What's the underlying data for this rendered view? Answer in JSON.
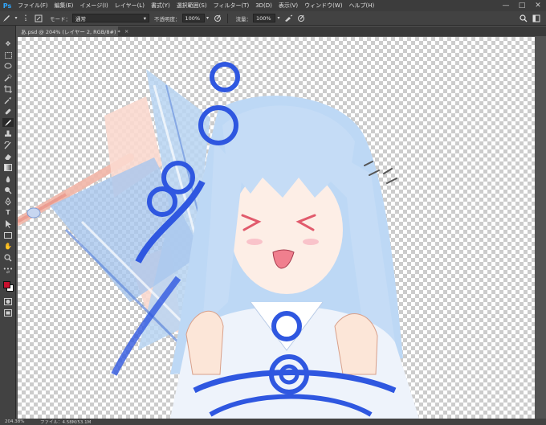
{
  "app": {
    "logo": "Ps"
  },
  "menu": [
    "ファイル(F)",
    "編集(E)",
    "イメージ(I)",
    "レイヤー(L)",
    "書式(Y)",
    "選択範囲(S)",
    "フィルター(T)",
    "3D(D)",
    "表示(V)",
    "ウィンドウ(W)",
    "ヘルプ(H)"
  ],
  "window_controls": {
    "minimize": "—",
    "maximize": "□",
    "close": "✕"
  },
  "options": {
    "brush_size": "1",
    "mode_label": "モード：",
    "mode_value": "通常",
    "opacity_label": "不透明度：",
    "opacity_value": "100%",
    "flow_label": "流量：",
    "flow_value": "100%"
  },
  "document": {
    "tab_title": "あ.psd @ 204% (レイヤー 2, RGB/8#) *",
    "close": "×"
  },
  "status": {
    "zoom": "204.38%",
    "file_info": "ファイル：4.58M/53.1M"
  },
  "colors": {
    "foreground": "#c8102e",
    "background": "#ffffff",
    "accent": "#31a8ff"
  },
  "icons": [
    "move-icon",
    "marquee-icon",
    "lasso-icon",
    "quick-select-icon",
    "crop-icon",
    "eyedropper-icon",
    "healing-icon",
    "brush-icon",
    "stamp-icon",
    "history-brush-icon",
    "eraser-icon",
    "gradient-icon",
    "blur-icon",
    "dodge-icon",
    "pen-icon",
    "type-icon",
    "path-select-icon",
    "rectangle-icon",
    "hand-icon",
    "zoom-icon",
    "more-icon",
    "quick-mask-icon",
    "screen-mode-icon"
  ]
}
